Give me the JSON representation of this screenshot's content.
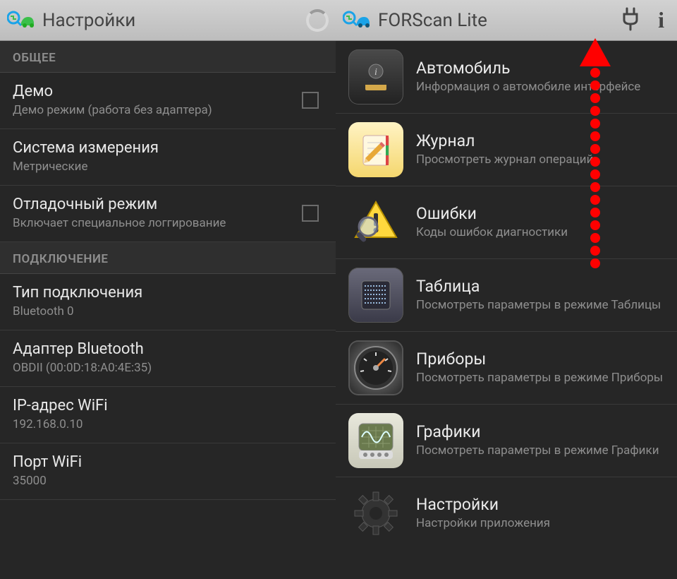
{
  "left": {
    "title": "Настройки",
    "sections": {
      "general": {
        "header": "ОБЩЕЕ",
        "demo": {
          "label": "Демо",
          "sub": "Демо режим (работа без адаптера)"
        },
        "measure": {
          "label": "Система измерения",
          "sub": "Метрические"
        },
        "debug": {
          "label": "Отладочный режим",
          "sub": "Включает специальное логгирование"
        }
      },
      "connection": {
        "header": "ПОДКЛЮЧЕНИЕ",
        "type": {
          "label": "Тип подключения",
          "sub": "Bluetooth 0"
        },
        "adapter": {
          "label": "Адаптер Bluetooth",
          "sub": "OBDII (00:0D:18:A0:4E:35)"
        },
        "ip": {
          "label": "IP-адрес WiFi",
          "sub": "192.168.0.10"
        },
        "port": {
          "label": "Порт WiFi",
          "sub": "35000"
        }
      }
    }
  },
  "right": {
    "title": "FORScan Lite",
    "menu": {
      "auto": {
        "title": "Автомобиль",
        "sub": "Информация о автомобиле интерфейсе"
      },
      "journal": {
        "title": "Журнал",
        "sub": "Просмотреть журнал операций"
      },
      "errors": {
        "title": "Ошибки",
        "sub": "Коды ошибок диагностики"
      },
      "table": {
        "title": "Таблица",
        "sub": "Посмотреть параметры в режиме Таблицы"
      },
      "gauge": {
        "title": "Приборы",
        "sub": "Посмотреть параметры в режиме Приборы"
      },
      "graph": {
        "title": "Графики",
        "sub": "Посмотреть параметры в режиме Графики"
      },
      "settings": {
        "title": "Настройки",
        "sub": "Настройки приложения"
      }
    }
  }
}
